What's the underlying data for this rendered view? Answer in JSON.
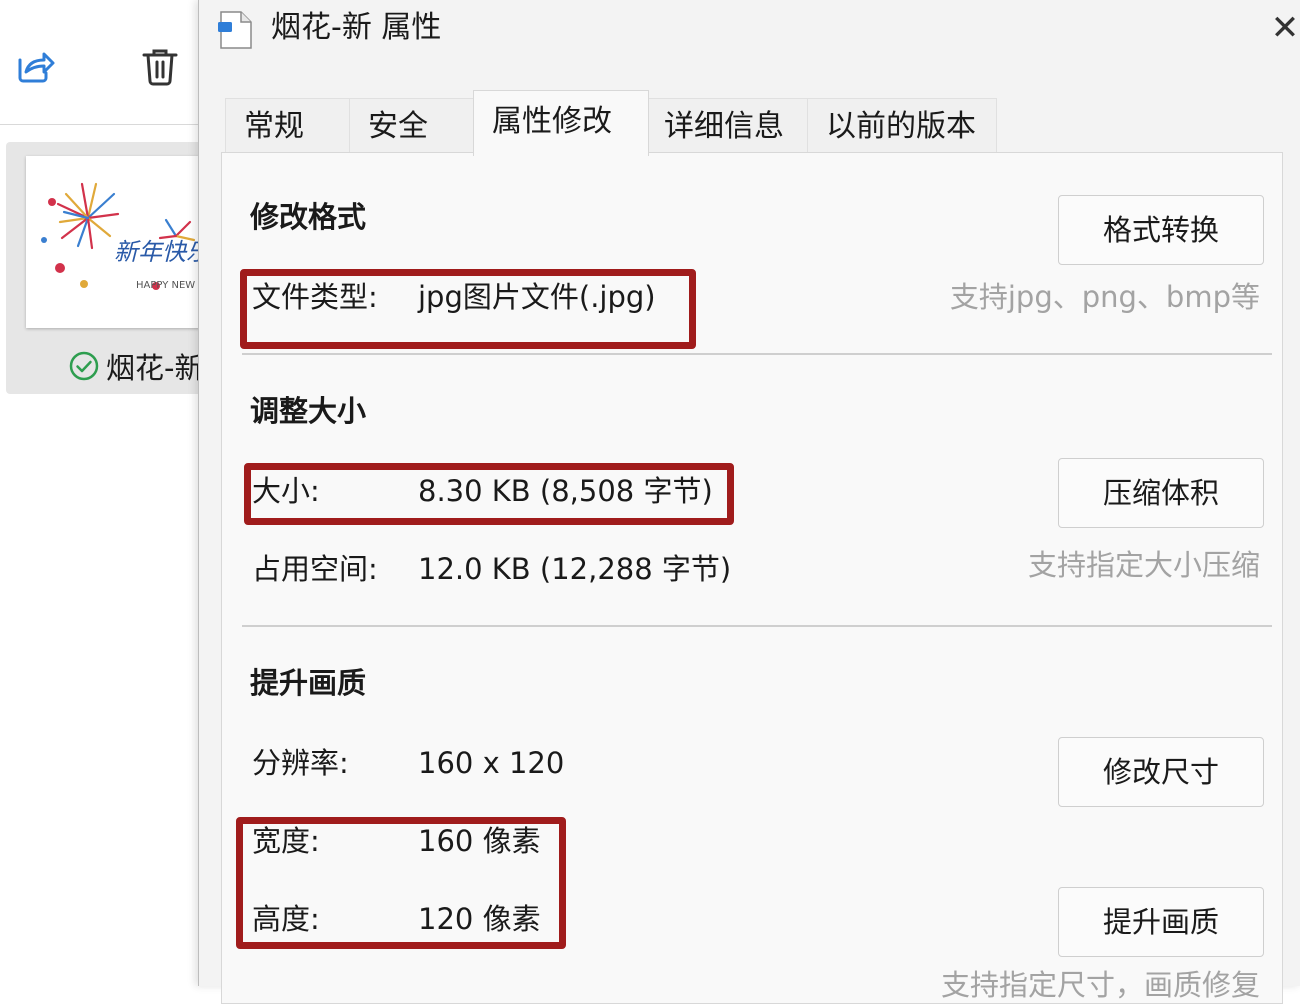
{
  "dialog": {
    "title": "烟花-新 属性",
    "close_symbol": "✕"
  },
  "explorer": {
    "file_name": "烟花-新",
    "thumbnail_text": "新年快乐",
    "thumbnail_subtext": "HAPPY NEW"
  },
  "tabs": [
    {
      "label": "常规"
    },
    {
      "label": "安全"
    },
    {
      "label": "属性修改"
    },
    {
      "label": "详细信息"
    },
    {
      "label": "以前的版本"
    }
  ],
  "active_tab": "属性修改",
  "format": {
    "section_title": "修改格式",
    "file_type_label": "文件类型:",
    "file_type_value": "jpg图片文件(.jpg)",
    "convert_button": "格式转换",
    "hint": "支持jpg、png、bmp等"
  },
  "resize": {
    "section_title": "调整大小",
    "size_label": "大小:",
    "size_value": "8.30 KB (8,508 字节)",
    "disk_label": "占用空间:",
    "disk_value": "12.0 KB (12,288 字节)",
    "compress_button": "压缩体积",
    "hint": "支持指定大小压缩"
  },
  "quality": {
    "section_title": "提升画质",
    "resolution_label": "分辨率:",
    "resolution_value": "160 x 120",
    "width_label": "宽度:",
    "width_value": "160 像素",
    "height_label": "高度:",
    "height_value": "120 像素",
    "resize_button": "修改尺寸",
    "enhance_button": "提升画质",
    "hint": "支持指定尺寸，画质修复"
  },
  "colors": {
    "highlight": "#a01c1c",
    "hint_text": "#a3a3a3",
    "accent": "#2f7ed8",
    "check": "#2e9e4f"
  },
  "icons": [
    "share-icon",
    "trash-icon",
    "check-circle-icon",
    "file-icon",
    "close-icon"
  ]
}
